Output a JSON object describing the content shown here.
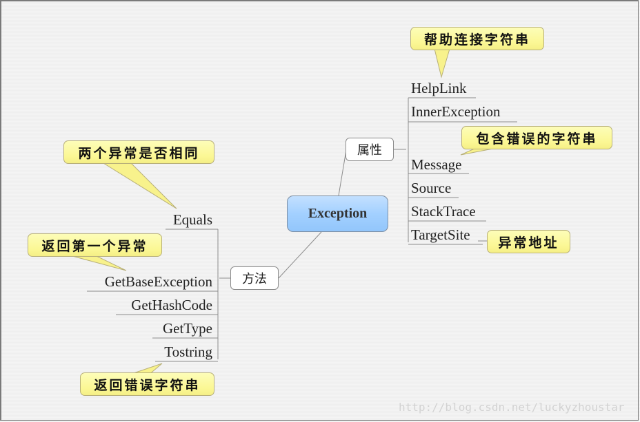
{
  "central": {
    "label": "Exception"
  },
  "branches": {
    "properties": {
      "label": "属性",
      "items": [
        "HelpLink",
        "InnerException",
        "Message",
        "Source",
        "StackTrace",
        "TargetSite"
      ]
    },
    "methods": {
      "label": "方法",
      "items": [
        "Equals",
        "GetBaseException",
        "GetHashCode",
        "GetType",
        "Tostring"
      ]
    }
  },
  "callouts": {
    "helplink": "帮助连接字符串",
    "message": "包含错误的字符串",
    "targetsite": "异常地址",
    "equals": "两个异常是否相同",
    "getbaseexception": "返回第一个异常",
    "tostring": "返回错误字符串"
  },
  "watermark": "http://blog.csdn.net/luckyzhoustar",
  "colors": {
    "central_fill": "#a3d0ff",
    "callout_fill": "#fbf794",
    "line": "#8c8c8c"
  }
}
